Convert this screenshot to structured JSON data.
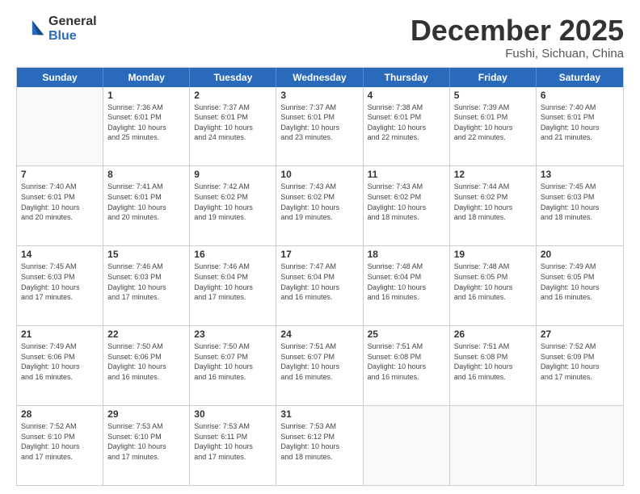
{
  "logo": {
    "general": "General",
    "blue": "Blue"
  },
  "header": {
    "month": "December 2025",
    "location": "Fushi, Sichuan, China"
  },
  "weekdays": [
    "Sunday",
    "Monday",
    "Tuesday",
    "Wednesday",
    "Thursday",
    "Friday",
    "Saturday"
  ],
  "weeks": [
    [
      {
        "day": "",
        "info": ""
      },
      {
        "day": "1",
        "info": "Sunrise: 7:36 AM\nSunset: 6:01 PM\nDaylight: 10 hours\nand 25 minutes."
      },
      {
        "day": "2",
        "info": "Sunrise: 7:37 AM\nSunset: 6:01 PM\nDaylight: 10 hours\nand 24 minutes."
      },
      {
        "day": "3",
        "info": "Sunrise: 7:37 AM\nSunset: 6:01 PM\nDaylight: 10 hours\nand 23 minutes."
      },
      {
        "day": "4",
        "info": "Sunrise: 7:38 AM\nSunset: 6:01 PM\nDaylight: 10 hours\nand 22 minutes."
      },
      {
        "day": "5",
        "info": "Sunrise: 7:39 AM\nSunset: 6:01 PM\nDaylight: 10 hours\nand 22 minutes."
      },
      {
        "day": "6",
        "info": "Sunrise: 7:40 AM\nSunset: 6:01 PM\nDaylight: 10 hours\nand 21 minutes."
      }
    ],
    [
      {
        "day": "7",
        "info": "Sunrise: 7:40 AM\nSunset: 6:01 PM\nDaylight: 10 hours\nand 20 minutes."
      },
      {
        "day": "8",
        "info": "Sunrise: 7:41 AM\nSunset: 6:01 PM\nDaylight: 10 hours\nand 20 minutes."
      },
      {
        "day": "9",
        "info": "Sunrise: 7:42 AM\nSunset: 6:02 PM\nDaylight: 10 hours\nand 19 minutes."
      },
      {
        "day": "10",
        "info": "Sunrise: 7:43 AM\nSunset: 6:02 PM\nDaylight: 10 hours\nand 19 minutes."
      },
      {
        "day": "11",
        "info": "Sunrise: 7:43 AM\nSunset: 6:02 PM\nDaylight: 10 hours\nand 18 minutes."
      },
      {
        "day": "12",
        "info": "Sunrise: 7:44 AM\nSunset: 6:02 PM\nDaylight: 10 hours\nand 18 minutes."
      },
      {
        "day": "13",
        "info": "Sunrise: 7:45 AM\nSunset: 6:03 PM\nDaylight: 10 hours\nand 18 minutes."
      }
    ],
    [
      {
        "day": "14",
        "info": "Sunrise: 7:45 AM\nSunset: 6:03 PM\nDaylight: 10 hours\nand 17 minutes."
      },
      {
        "day": "15",
        "info": "Sunrise: 7:46 AM\nSunset: 6:03 PM\nDaylight: 10 hours\nand 17 minutes."
      },
      {
        "day": "16",
        "info": "Sunrise: 7:46 AM\nSunset: 6:04 PM\nDaylight: 10 hours\nand 17 minutes."
      },
      {
        "day": "17",
        "info": "Sunrise: 7:47 AM\nSunset: 6:04 PM\nDaylight: 10 hours\nand 16 minutes."
      },
      {
        "day": "18",
        "info": "Sunrise: 7:48 AM\nSunset: 6:04 PM\nDaylight: 10 hours\nand 16 minutes."
      },
      {
        "day": "19",
        "info": "Sunrise: 7:48 AM\nSunset: 6:05 PM\nDaylight: 10 hours\nand 16 minutes."
      },
      {
        "day": "20",
        "info": "Sunrise: 7:49 AM\nSunset: 6:05 PM\nDaylight: 10 hours\nand 16 minutes."
      }
    ],
    [
      {
        "day": "21",
        "info": "Sunrise: 7:49 AM\nSunset: 6:06 PM\nDaylight: 10 hours\nand 16 minutes."
      },
      {
        "day": "22",
        "info": "Sunrise: 7:50 AM\nSunset: 6:06 PM\nDaylight: 10 hours\nand 16 minutes."
      },
      {
        "day": "23",
        "info": "Sunrise: 7:50 AM\nSunset: 6:07 PM\nDaylight: 10 hours\nand 16 minutes."
      },
      {
        "day": "24",
        "info": "Sunrise: 7:51 AM\nSunset: 6:07 PM\nDaylight: 10 hours\nand 16 minutes."
      },
      {
        "day": "25",
        "info": "Sunrise: 7:51 AM\nSunset: 6:08 PM\nDaylight: 10 hours\nand 16 minutes."
      },
      {
        "day": "26",
        "info": "Sunrise: 7:51 AM\nSunset: 6:08 PM\nDaylight: 10 hours\nand 16 minutes."
      },
      {
        "day": "27",
        "info": "Sunrise: 7:52 AM\nSunset: 6:09 PM\nDaylight: 10 hours\nand 17 minutes."
      }
    ],
    [
      {
        "day": "28",
        "info": "Sunrise: 7:52 AM\nSunset: 6:10 PM\nDaylight: 10 hours\nand 17 minutes."
      },
      {
        "day": "29",
        "info": "Sunrise: 7:53 AM\nSunset: 6:10 PM\nDaylight: 10 hours\nand 17 minutes."
      },
      {
        "day": "30",
        "info": "Sunrise: 7:53 AM\nSunset: 6:11 PM\nDaylight: 10 hours\nand 17 minutes."
      },
      {
        "day": "31",
        "info": "Sunrise: 7:53 AM\nSunset: 6:12 PM\nDaylight: 10 hours\nand 18 minutes."
      },
      {
        "day": "",
        "info": ""
      },
      {
        "day": "",
        "info": ""
      },
      {
        "day": "",
        "info": ""
      }
    ]
  ]
}
